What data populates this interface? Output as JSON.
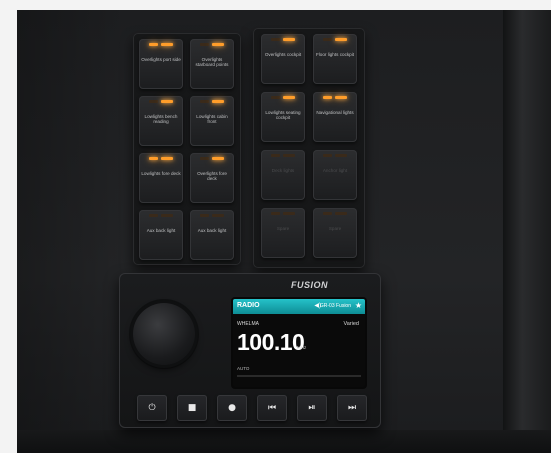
{
  "switch_panel_left": {
    "switches": [
      {
        "label": "Overlights port side",
        "led1": true,
        "led2": true
      },
      {
        "label": "Overlights starboard points",
        "led1": false,
        "led2": true
      },
      {
        "label": "Lowlights bench reading",
        "led1": false,
        "led2": true
      },
      {
        "label": "Lowlights cabin front",
        "led1": false,
        "led2": true
      },
      {
        "label": "Lowlights fore deck",
        "led1": true,
        "led2": true
      },
      {
        "label": "Overlights fore deck",
        "led1": false,
        "led2": true
      },
      {
        "label": "Aux back light",
        "led1": false,
        "led2": false
      },
      {
        "label": "Aux back light",
        "led1": false,
        "led2": false
      }
    ]
  },
  "switch_panel_right": {
    "switches": [
      {
        "label": "Overlights cockpit",
        "led1": false,
        "led2": true,
        "dim": false
      },
      {
        "label": "Floor lights cockpit",
        "led1": false,
        "led2": true,
        "dim": false
      },
      {
        "label": "Lowlights seating cockpit",
        "led1": false,
        "led2": true,
        "dim": false
      },
      {
        "label": "Navigational lights",
        "led1": true,
        "led2": true,
        "dim": false
      },
      {
        "label": "Deck lights",
        "led1": false,
        "led2": false,
        "dim": true
      },
      {
        "label": "Anchor light",
        "led1": false,
        "led2": false,
        "dim": true
      },
      {
        "label": "Spare",
        "led1": false,
        "led2": false,
        "dim": true
      },
      {
        "label": "Spare",
        "led1": false,
        "led2": false,
        "dim": true
      }
    ]
  },
  "stereo": {
    "brand": "FUSION",
    "screen": {
      "mode": "RADIO",
      "source": "GR-03 Fusion",
      "band": "WHELMA",
      "status": "Varied",
      "frequency": "100.10",
      "unit": "MHz",
      "tuning": "AUTO"
    },
    "buttons": [
      {
        "name": "power",
        "glyph": "⏻"
      },
      {
        "name": "stop",
        "glyph": "■"
      },
      {
        "name": "menu",
        "glyph": "●"
      },
      {
        "name": "previous",
        "glyph": "⏮"
      },
      {
        "name": "play-pause",
        "glyph": "⏯"
      },
      {
        "name": "next",
        "glyph": "⏭"
      }
    ]
  },
  "colors": {
    "led_on": "#ff9d2a",
    "screen_accent": "#25c2c9"
  }
}
